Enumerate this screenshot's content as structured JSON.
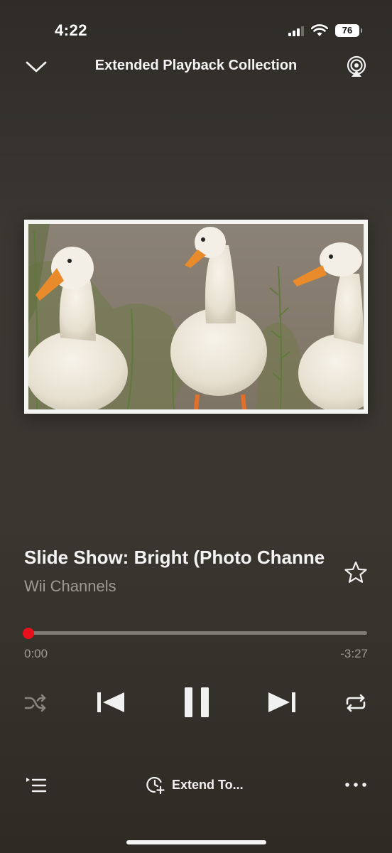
{
  "status_bar": {
    "time": "4:22",
    "battery": "76",
    "icons": [
      "cellular-signal-icon",
      "wifi-icon",
      "battery-icon"
    ]
  },
  "header": {
    "title": "Extended Playback Collection",
    "left_icon": "chevron-down-icon",
    "right_icon": "airplay-icon"
  },
  "artwork": {
    "icon": "album-artwork-ducks"
  },
  "track": {
    "title": "Slide Show: Bright (Photo Channe",
    "artist": "Wii Channels",
    "favorite_icon": "star-outline-icon"
  },
  "progress": {
    "elapsed": "0:00",
    "remaining": "-3:27",
    "fraction": 0.0
  },
  "controls": {
    "icons": [
      "shuffle-icon",
      "previous-track-icon",
      "pause-icon",
      "next-track-icon",
      "repeat-icon"
    ]
  },
  "bottom_bar": {
    "queue_icon": "queue-list-icon",
    "extend_label": "Extend To...",
    "extend_icon": "clock-plus-icon",
    "more_icon": "more-dots-icon"
  },
  "colors": {
    "background": "#3a3630",
    "accent_knob": "#e8101a",
    "secondary_text": "#9e9a93"
  }
}
